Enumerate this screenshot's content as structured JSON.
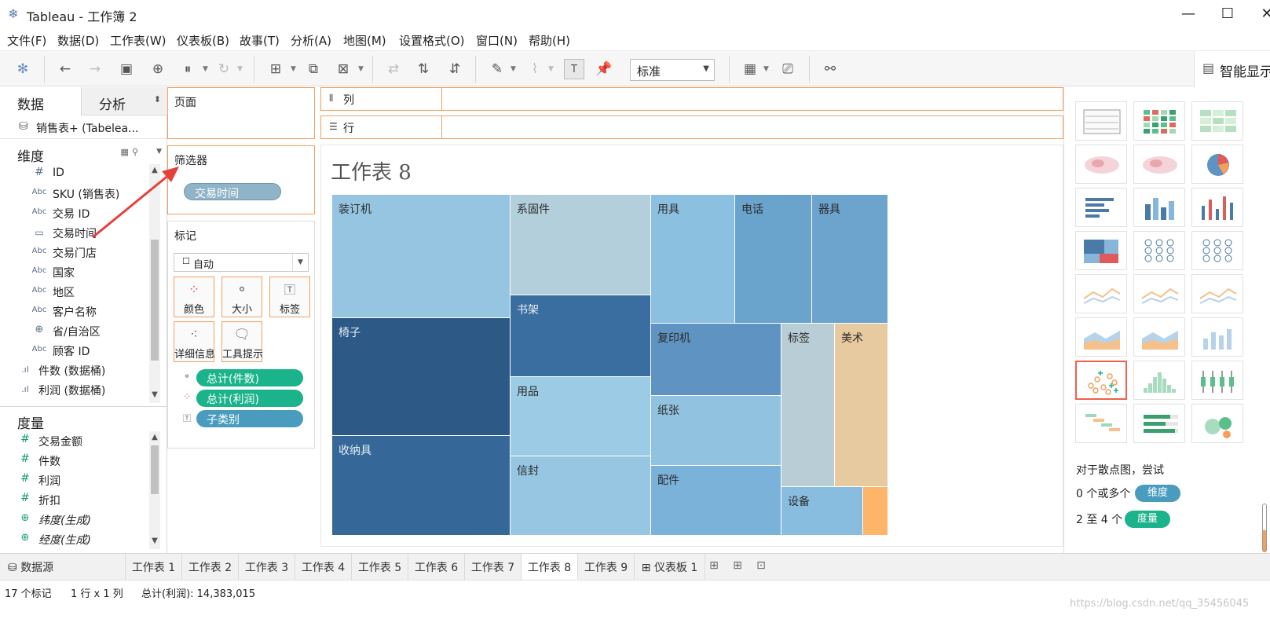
{
  "window": {
    "title": "Tableau - 工作簿 2",
    "min": "—",
    "max": "☐",
    "close": "✕"
  },
  "menu": [
    "文件(F)",
    "数据(D)",
    "工作表(W)",
    "仪表板(B)",
    "故事(T)",
    "分析(A)",
    "地图(M)",
    "设置格式(O)",
    "窗口(N)",
    "帮助(H)"
  ],
  "toolbar": {
    "fit_value": "标准",
    "show_me_label": "智能显示"
  },
  "left_pane": {
    "tab_data": "数据",
    "tab_analysis": "分析",
    "datasource": "销售表+ (Tabelea...",
    "dimensions_label": "维度",
    "dimensions": [
      {
        "icon": "#",
        "name": "ID"
      },
      {
        "icon": "Abc",
        "name": "SKU (销售表)"
      },
      {
        "icon": "Abc",
        "name": "交易 ID"
      },
      {
        "icon": "date",
        "name": "交易时间"
      },
      {
        "icon": "Abc",
        "name": "交易门店"
      },
      {
        "icon": "Abc",
        "name": "国家"
      },
      {
        "icon": "Abc",
        "name": "地区"
      },
      {
        "icon": "Abc",
        "name": "客户名称"
      },
      {
        "icon": "globe",
        "name": "省/自治区"
      },
      {
        "icon": "Abc",
        "name": "顾客 ID"
      },
      {
        "icon": "bin",
        "name": "件数 (数据桶)"
      },
      {
        "icon": "bin",
        "name": "利润 (数据桶)"
      }
    ],
    "measures_label": "度量",
    "measures": [
      {
        "icon": "#",
        "name": "交易金额"
      },
      {
        "icon": "#",
        "name": "件数"
      },
      {
        "icon": "#",
        "name": "利润"
      },
      {
        "icon": "#",
        "name": "折扣"
      },
      {
        "icon": "globe",
        "name": "纬度(生成)"
      },
      {
        "icon": "globe",
        "name": "经度(生成)"
      }
    ]
  },
  "cards": {
    "pages": "页面",
    "filters": "筛选器",
    "filter_pill": "交易时间",
    "marks": "标记",
    "mark_type": "自动",
    "mark_buttons": [
      "颜色",
      "大小",
      "标签",
      "详细信息",
      "工具提示"
    ],
    "encodings": [
      {
        "icon": "size",
        "label": "总计(件数)",
        "color": "#1ab38b"
      },
      {
        "icon": "color",
        "label": "总计(利润)",
        "color": "#1ab38b"
      },
      {
        "icon": "text",
        "label": "子类别",
        "color": "#4a9cbf"
      }
    ]
  },
  "shelves": {
    "columns": "列",
    "rows": "行"
  },
  "sheet": {
    "title": "工作表 8",
    "tiles": [
      {
        "label": "装订机",
        "color": "#95c5e0"
      },
      {
        "label": "椅子",
        "color": "#2c5986"
      },
      {
        "label": "收纳具",
        "color": "#356898"
      },
      {
        "label": "系固件",
        "color": "#b3cfdb"
      },
      {
        "label": "书架",
        "color": "#3b6ea0"
      },
      {
        "label": "用品",
        "color": "#9ccbe5"
      },
      {
        "label": "信封",
        "color": "#97c6e3"
      },
      {
        "label": "用具",
        "color": "#8cc0e0"
      },
      {
        "label": "电话",
        "color": "#6aa3cc"
      },
      {
        "label": "器具",
        "color": "#6ca4cd"
      },
      {
        "label": "复印机",
        "color": "#5f93c1"
      },
      {
        "label": "纸张",
        "color": "#91c3e1"
      },
      {
        "label": "配件",
        "color": "#7bb2d9"
      },
      {
        "label": "标签",
        "color": "#b8cdd6"
      },
      {
        "label": "美术",
        "color": "#e8caa0"
      },
      {
        "label": "设备",
        "color": "#89bde0"
      },
      {
        "label": "",
        "color": "#fdb56a"
      }
    ]
  },
  "show_me": {
    "hint": "对于散点图，尝试",
    "row1_text": "0 个或多个",
    "row1_pill": "维度",
    "row2_text": "2 至 4 个",
    "row2_pill": "度量",
    "accent_dimension": "#4a9cbf",
    "accent_measure": "#1ab38b"
  },
  "tabs": {
    "datasource": "数据源",
    "sheets": [
      "工作表 1",
      "工作表 2",
      "工作表 3",
      "工作表 4",
      "工作表 5",
      "工作表 6",
      "工作表 7",
      "工作表 8",
      "工作表 9"
    ],
    "dashboard": "仪表板 1",
    "active": "工作表 8"
  },
  "status": {
    "marks": "17 个标记",
    "rows_cols": "1 行 x 1 列",
    "sum": "总计(利润): 14,383,015",
    "watermark": "https://blog.csdn.net/qq_35456045"
  }
}
